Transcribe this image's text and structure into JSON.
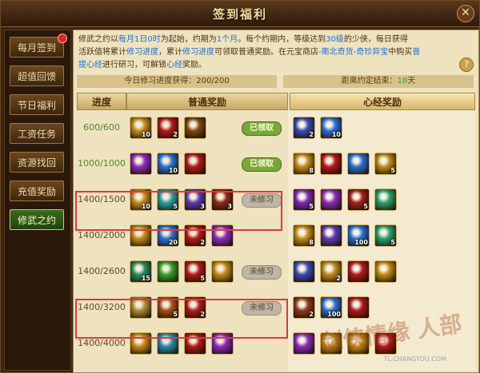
{
  "window": {
    "title": "签到福利"
  },
  "nav": {
    "items": [
      {
        "label": "每月签到",
        "active": false,
        "dot": true
      },
      {
        "label": "超值回馈",
        "active": false,
        "dot": false
      },
      {
        "label": "节日福利",
        "active": false,
        "dot": false
      },
      {
        "label": "工资任务",
        "active": false,
        "dot": false
      },
      {
        "label": "资源找回",
        "active": false,
        "dot": false
      },
      {
        "label": "充值奖励",
        "active": false,
        "dot": false
      },
      {
        "label": "修武之约",
        "active": true,
        "dot": false
      }
    ]
  },
  "info": {
    "line1a": "修武之约以",
    "line1b": "每月1日0时",
    "line1c": "为起始，约期为",
    "line1d": "1个月",
    "line1e": "。每个约期内，等级达到",
    "line1f": "30级",
    "line1g": "的少侠，每日获得",
    "line2a": "活跃值将累计",
    "line2b": "修习进度",
    "line2c": "，累计",
    "line2d": "修习进度",
    "line2e": "可领取普通奖励。在元宝商店",
    "line2f": "-南北奇货-奇珍异宝",
    "line2g": "中购买",
    "line2h": "普",
    "line3a": "提心经",
    "line3b": "进行研习，可解锁",
    "line3c": "心经",
    "line3d": "奖励。",
    "help": "?",
    "progress_label": "今日修习进度获得：200/200",
    "expire_label": "距离约定结束：",
    "expire_value": "18",
    "expire_unit": "天"
  },
  "table": {
    "col_req": "进度",
    "col_normal": "普通奖励",
    "col_heart": "心经奖励",
    "rows": [
      {
        "req": "600/600",
        "status": "已领取",
        "claimed": true
      },
      {
        "req": "1000/1000",
        "status": "已领取",
        "claimed": true
      },
      {
        "req": "1400/1500",
        "status": "未修习",
        "claimed": false
      },
      {
        "req": "1400/2000",
        "status": "",
        "claimed": false
      },
      {
        "req": "1400/2600",
        "status": "未修习",
        "claimed": false
      },
      {
        "req": "1400/3200",
        "status": "未修习",
        "claimed": false
      },
      {
        "req": "1400/4000",
        "status": "",
        "claimed": false
      }
    ]
  },
  "rewards": {
    "normal": [
      [
        {
          "q": "10",
          "c": "#c08a1a"
        },
        {
          "q": "2",
          "c": "#b11a1a"
        },
        {
          "q": "",
          "c": "#7a4a10"
        }
      ],
      [
        {
          "q": "",
          "c": "#8b2ab8"
        },
        {
          "q": "10",
          "c": "#2a6fd1"
        },
        {
          "q": "",
          "c": "#b11a1a"
        }
      ],
      [
        {
          "q": "10",
          "c": "#c08a1a"
        },
        {
          "q": "5",
          "c": "#2aa0a0"
        },
        {
          "q": "3",
          "c": "#5a3ab0"
        },
        {
          "q": "3",
          "c": "#8a2a1a"
        }
      ],
      [
        {
          "q": "",
          "c": "#c08a1a"
        },
        {
          "q": "20",
          "c": "#2a6fd1"
        },
        {
          "q": "2",
          "c": "#b11a1a"
        },
        {
          "q": "",
          "c": "#8b2ab8"
        }
      ],
      [
        {
          "q": "15",
          "c": "#2a8a5a"
        },
        {
          "q": "",
          "c": "#3aa02a"
        },
        {
          "q": "5",
          "c": "#b11a1a"
        },
        {
          "q": "",
          "c": "#c08a1a"
        }
      ],
      [
        {
          "q": "",
          "c": "#b08a3a"
        },
        {
          "q": "5",
          "c": "#a0501a"
        },
        {
          "q": "2",
          "c": "#b11a1a"
        }
      ],
      [
        {
          "q": "",
          "c": "#c08a1a"
        },
        {
          "q": "",
          "c": "#2a8ab0"
        },
        {
          "q": "",
          "c": "#b11a1a"
        },
        {
          "q": "",
          "c": "#8b2ab8"
        }
      ]
    ],
    "heart": [
      [
        {
          "q": "2",
          "c": "#3a4ab0"
        },
        {
          "q": "10",
          "c": "#2a6fd1"
        }
      ],
      [
        {
          "q": "8",
          "c": "#c08a1a"
        },
        {
          "q": "",
          "c": "#b11a1a"
        },
        {
          "q": "",
          "c": "#2a6fd1"
        },
        {
          "q": "5",
          "c": "#c08a1a"
        }
      ],
      [
        {
          "q": "5",
          "c": "#7a2ab0"
        },
        {
          "q": "",
          "c": "#8b2ab8"
        },
        {
          "q": "5",
          "c": "#a0201a"
        },
        {
          "q": "",
          "c": "#2aa06a"
        }
      ],
      [
        {
          "q": "8",
          "c": "#c08a1a"
        },
        {
          "q": "",
          "c": "#5a3ab0"
        },
        {
          "q": "100",
          "c": "#2a6fd1"
        },
        {
          "q": "5",
          "c": "#2aa06a"
        }
      ],
      [
        {
          "q": "",
          "c": "#3a4ab0"
        },
        {
          "q": "2",
          "c": "#c08a1a"
        },
        {
          "q": "",
          "c": "#b11a1a"
        },
        {
          "q": "",
          "c": "#c08a1a"
        }
      ],
      [
        {
          "q": "2",
          "c": "#8a3a1a"
        },
        {
          "q": "100",
          "c": "#2a6fd1"
        },
        {
          "q": "",
          "c": "#b11a1a"
        }
      ],
      [
        {
          "q": "",
          "c": "#8b2ab8"
        },
        {
          "q": "",
          "c": "#c08a1a"
        },
        {
          "q": "",
          "c": "#c08a1a"
        },
        {
          "q": "",
          "c": "#b11a1a"
        }
      ]
    ]
  },
  "watermark": {
    "big": "剑侠情缘 人部",
    "small": "TL.CHANGYOU.COM"
  }
}
